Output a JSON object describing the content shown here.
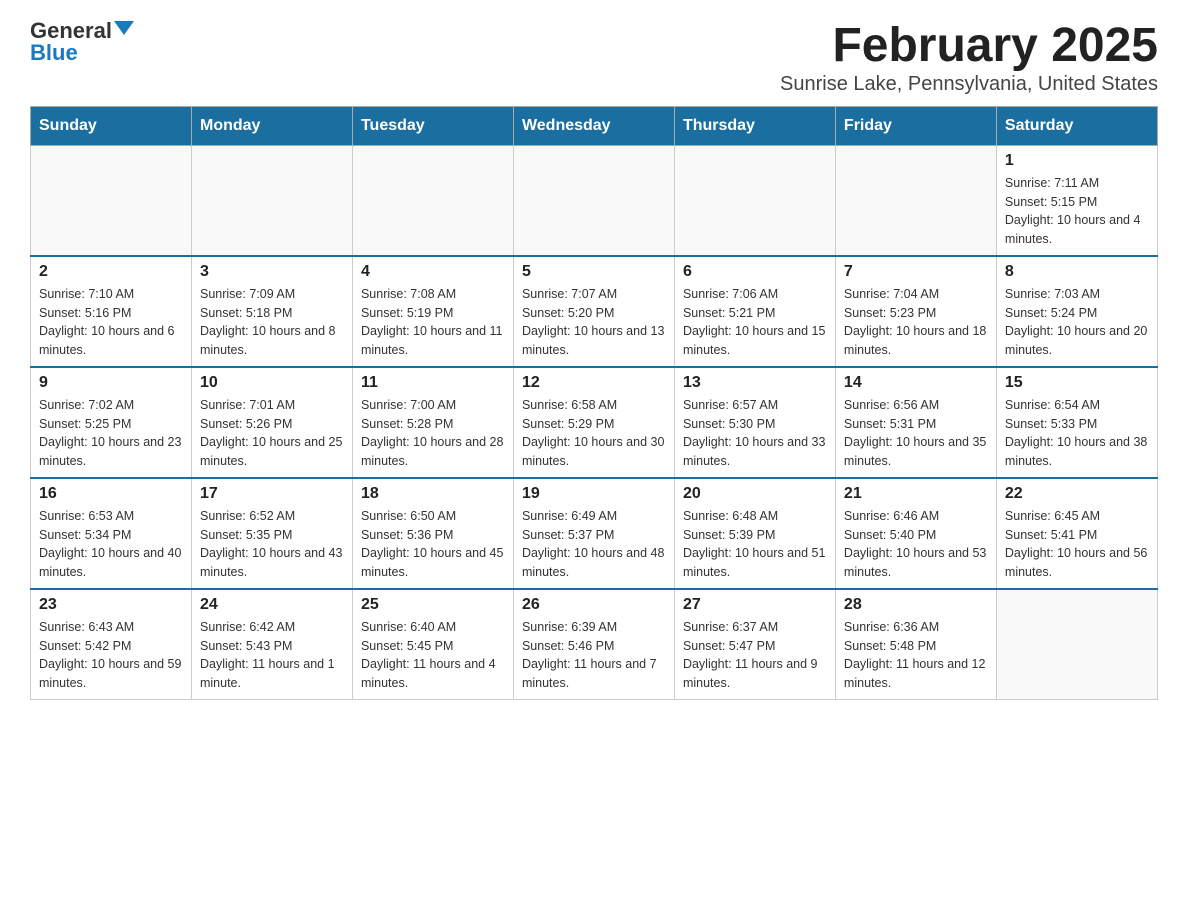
{
  "logo": {
    "general": "General",
    "blue": "Blue"
  },
  "header": {
    "title": "February 2025",
    "location": "Sunrise Lake, Pennsylvania, United States"
  },
  "weekdays": [
    "Sunday",
    "Monday",
    "Tuesday",
    "Wednesday",
    "Thursday",
    "Friday",
    "Saturday"
  ],
  "weeks": [
    [
      {
        "day": "",
        "info": ""
      },
      {
        "day": "",
        "info": ""
      },
      {
        "day": "",
        "info": ""
      },
      {
        "day": "",
        "info": ""
      },
      {
        "day": "",
        "info": ""
      },
      {
        "day": "",
        "info": ""
      },
      {
        "day": "1",
        "info": "Sunrise: 7:11 AM\nSunset: 5:15 PM\nDaylight: 10 hours and 4 minutes."
      }
    ],
    [
      {
        "day": "2",
        "info": "Sunrise: 7:10 AM\nSunset: 5:16 PM\nDaylight: 10 hours and 6 minutes."
      },
      {
        "day": "3",
        "info": "Sunrise: 7:09 AM\nSunset: 5:18 PM\nDaylight: 10 hours and 8 minutes."
      },
      {
        "day": "4",
        "info": "Sunrise: 7:08 AM\nSunset: 5:19 PM\nDaylight: 10 hours and 11 minutes."
      },
      {
        "day": "5",
        "info": "Sunrise: 7:07 AM\nSunset: 5:20 PM\nDaylight: 10 hours and 13 minutes."
      },
      {
        "day": "6",
        "info": "Sunrise: 7:06 AM\nSunset: 5:21 PM\nDaylight: 10 hours and 15 minutes."
      },
      {
        "day": "7",
        "info": "Sunrise: 7:04 AM\nSunset: 5:23 PM\nDaylight: 10 hours and 18 minutes."
      },
      {
        "day": "8",
        "info": "Sunrise: 7:03 AM\nSunset: 5:24 PM\nDaylight: 10 hours and 20 minutes."
      }
    ],
    [
      {
        "day": "9",
        "info": "Sunrise: 7:02 AM\nSunset: 5:25 PM\nDaylight: 10 hours and 23 minutes."
      },
      {
        "day": "10",
        "info": "Sunrise: 7:01 AM\nSunset: 5:26 PM\nDaylight: 10 hours and 25 minutes."
      },
      {
        "day": "11",
        "info": "Sunrise: 7:00 AM\nSunset: 5:28 PM\nDaylight: 10 hours and 28 minutes."
      },
      {
        "day": "12",
        "info": "Sunrise: 6:58 AM\nSunset: 5:29 PM\nDaylight: 10 hours and 30 minutes."
      },
      {
        "day": "13",
        "info": "Sunrise: 6:57 AM\nSunset: 5:30 PM\nDaylight: 10 hours and 33 minutes."
      },
      {
        "day": "14",
        "info": "Sunrise: 6:56 AM\nSunset: 5:31 PM\nDaylight: 10 hours and 35 minutes."
      },
      {
        "day": "15",
        "info": "Sunrise: 6:54 AM\nSunset: 5:33 PM\nDaylight: 10 hours and 38 minutes."
      }
    ],
    [
      {
        "day": "16",
        "info": "Sunrise: 6:53 AM\nSunset: 5:34 PM\nDaylight: 10 hours and 40 minutes."
      },
      {
        "day": "17",
        "info": "Sunrise: 6:52 AM\nSunset: 5:35 PM\nDaylight: 10 hours and 43 minutes."
      },
      {
        "day": "18",
        "info": "Sunrise: 6:50 AM\nSunset: 5:36 PM\nDaylight: 10 hours and 45 minutes."
      },
      {
        "day": "19",
        "info": "Sunrise: 6:49 AM\nSunset: 5:37 PM\nDaylight: 10 hours and 48 minutes."
      },
      {
        "day": "20",
        "info": "Sunrise: 6:48 AM\nSunset: 5:39 PM\nDaylight: 10 hours and 51 minutes."
      },
      {
        "day": "21",
        "info": "Sunrise: 6:46 AM\nSunset: 5:40 PM\nDaylight: 10 hours and 53 minutes."
      },
      {
        "day": "22",
        "info": "Sunrise: 6:45 AM\nSunset: 5:41 PM\nDaylight: 10 hours and 56 minutes."
      }
    ],
    [
      {
        "day": "23",
        "info": "Sunrise: 6:43 AM\nSunset: 5:42 PM\nDaylight: 10 hours and 59 minutes."
      },
      {
        "day": "24",
        "info": "Sunrise: 6:42 AM\nSunset: 5:43 PM\nDaylight: 11 hours and 1 minute."
      },
      {
        "day": "25",
        "info": "Sunrise: 6:40 AM\nSunset: 5:45 PM\nDaylight: 11 hours and 4 minutes."
      },
      {
        "day": "26",
        "info": "Sunrise: 6:39 AM\nSunset: 5:46 PM\nDaylight: 11 hours and 7 minutes."
      },
      {
        "day": "27",
        "info": "Sunrise: 6:37 AM\nSunset: 5:47 PM\nDaylight: 11 hours and 9 minutes."
      },
      {
        "day": "28",
        "info": "Sunrise: 6:36 AM\nSunset: 5:48 PM\nDaylight: 11 hours and 12 minutes."
      },
      {
        "day": "",
        "info": ""
      }
    ]
  ]
}
